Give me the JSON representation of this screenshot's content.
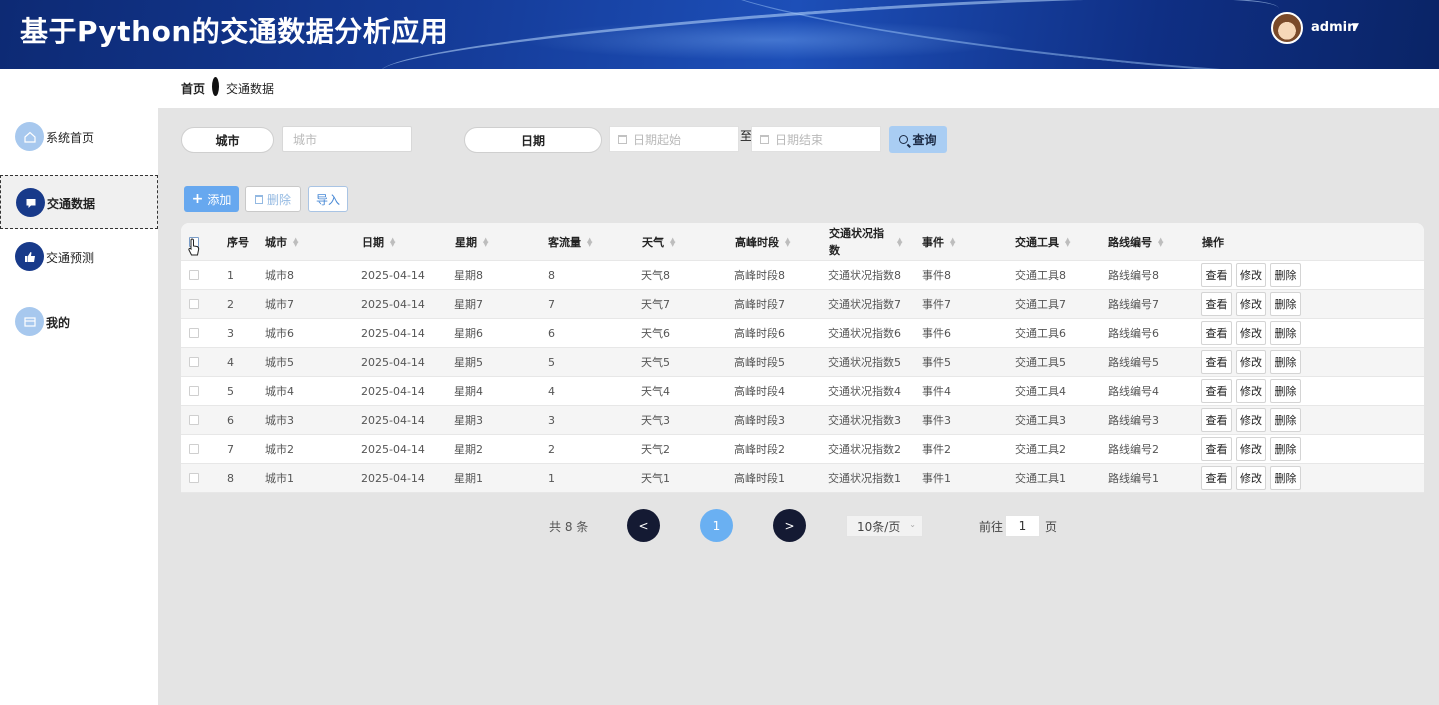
{
  "header": {
    "title": "基于Python的交通数据分析应用",
    "username": "admin"
  },
  "sidebar": {
    "items": [
      {
        "label": "系统首页",
        "icon": "home-icon"
      },
      {
        "label": "交通数据",
        "icon": "chat-icon"
      },
      {
        "label": "交通预测",
        "icon": "thumb-icon"
      },
      {
        "label": "我的",
        "icon": "card-icon"
      }
    ]
  },
  "breadcrumb": {
    "home": "首页",
    "current": "交通数据"
  },
  "search": {
    "city_label": "城市",
    "city_placeholder": "城市",
    "date_label": "日期",
    "date_start_placeholder": "日期起始",
    "date_end_placeholder": "日期结束",
    "to_text": "至",
    "query_label": "查询"
  },
  "actions": {
    "add": "添加",
    "delete": "删除",
    "import": "导入"
  },
  "table": {
    "headers": {
      "index": "序号",
      "city": "城市",
      "date": "日期",
      "weekday": "星期",
      "flow": "客流量",
      "weather": "天气",
      "peak": "高峰时段",
      "status_line1": "交通状况指",
      "status_line2": "数",
      "event": "事件",
      "tool": "交通工具",
      "route": "路线编号",
      "ops": "操作"
    },
    "ops": {
      "view": "查看",
      "edit": "修改",
      "delete": "删除"
    },
    "rows": [
      {
        "index": "1",
        "city": "城市8",
        "date": "2025-04-14",
        "weekday": "星期8",
        "flow": "8",
        "weather": "天气8",
        "peak": "高峰时段8",
        "status": "交通状况指数8",
        "event": "事件8",
        "tool": "交通工具8",
        "route": "路线编号8"
      },
      {
        "index": "2",
        "city": "城市7",
        "date": "2025-04-14",
        "weekday": "星期7",
        "flow": "7",
        "weather": "天气7",
        "peak": "高峰时段7",
        "status": "交通状况指数7",
        "event": "事件7",
        "tool": "交通工具7",
        "route": "路线编号7"
      },
      {
        "index": "3",
        "city": "城市6",
        "date": "2025-04-14",
        "weekday": "星期6",
        "flow": "6",
        "weather": "天气6",
        "peak": "高峰时段6",
        "status": "交通状况指数6",
        "event": "事件6",
        "tool": "交通工具6",
        "route": "路线编号6"
      },
      {
        "index": "4",
        "city": "城市5",
        "date": "2025-04-14",
        "weekday": "星期5",
        "flow": "5",
        "weather": "天气5",
        "peak": "高峰时段5",
        "status": "交通状况指数5",
        "event": "事件5",
        "tool": "交通工具5",
        "route": "路线编号5"
      },
      {
        "index": "5",
        "city": "城市4",
        "date": "2025-04-14",
        "weekday": "星期4",
        "flow": "4",
        "weather": "天气4",
        "peak": "高峰时段4",
        "status": "交通状况指数4",
        "event": "事件4",
        "tool": "交通工具4",
        "route": "路线编号4"
      },
      {
        "index": "6",
        "city": "城市3",
        "date": "2025-04-14",
        "weekday": "星期3",
        "flow": "3",
        "weather": "天气3",
        "peak": "高峰时段3",
        "status": "交通状况指数3",
        "event": "事件3",
        "tool": "交通工具3",
        "route": "路线编号3"
      },
      {
        "index": "7",
        "city": "城市2",
        "date": "2025-04-14",
        "weekday": "星期2",
        "flow": "2",
        "weather": "天气2",
        "peak": "高峰时段2",
        "status": "交通状况指数2",
        "event": "事件2",
        "tool": "交通工具2",
        "route": "路线编号2"
      },
      {
        "index": "8",
        "city": "城市1",
        "date": "2025-04-14",
        "weekday": "星期1",
        "flow": "1",
        "weather": "天气1",
        "peak": "高峰时段1",
        "status": "交通状况指数1",
        "event": "事件1",
        "tool": "交通工具1",
        "route": "路线编号1"
      }
    ]
  },
  "pagination": {
    "total_text": "共 8 条",
    "prev": "<",
    "current": "1",
    "next": ">",
    "page_size": "10条/页",
    "goto_label": "前往",
    "goto_value": "1",
    "goto_unit": "页"
  },
  "colors": {
    "header": "#143a96",
    "accent": "#67a8ef",
    "pager_dark": "#141a33",
    "pager_current": "#6ab0f2"
  }
}
